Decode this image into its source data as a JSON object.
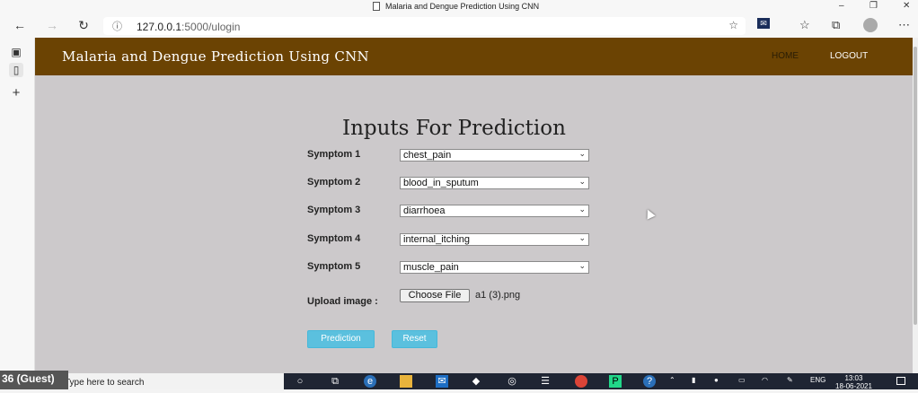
{
  "browser": {
    "tab_title": "Malaria and Dengue Prediction Using CNN",
    "url_host": "127.0.0.1",
    "url_rest": ":5000/ulogin",
    "window_controls": [
      "–",
      "❐",
      "✕"
    ]
  },
  "site": {
    "brand": "Malaria and Dengue Prediction Using CNN",
    "nav": {
      "home": "HOME",
      "logout": "LOGOUT"
    },
    "header_color": "#6b4303"
  },
  "form": {
    "title": "Inputs For Prediction",
    "symptoms": [
      {
        "label": "Symptom 1",
        "value": "chest_pain"
      },
      {
        "label": "Symptom 2",
        "value": "blood_in_sputum"
      },
      {
        "label": "Symptom 3",
        "value": "diarrhoea"
      },
      {
        "label": "Symptom 4",
        "value": "internal_itching"
      },
      {
        "label": "Symptom 5",
        "value": "muscle_pain"
      }
    ],
    "upload_label": "Upload image :",
    "choose_file_label": "Choose File",
    "file_name": "a1 (3).png",
    "prediction_button": "Prediction",
    "reset_button": "Reset",
    "button_color": "#5bc0de"
  },
  "taskbar": {
    "guest_label": "36 (Guest)",
    "search_placeholder": "Type here to search",
    "language": "ENG",
    "time": "13:03",
    "date": "18-06-2021"
  }
}
